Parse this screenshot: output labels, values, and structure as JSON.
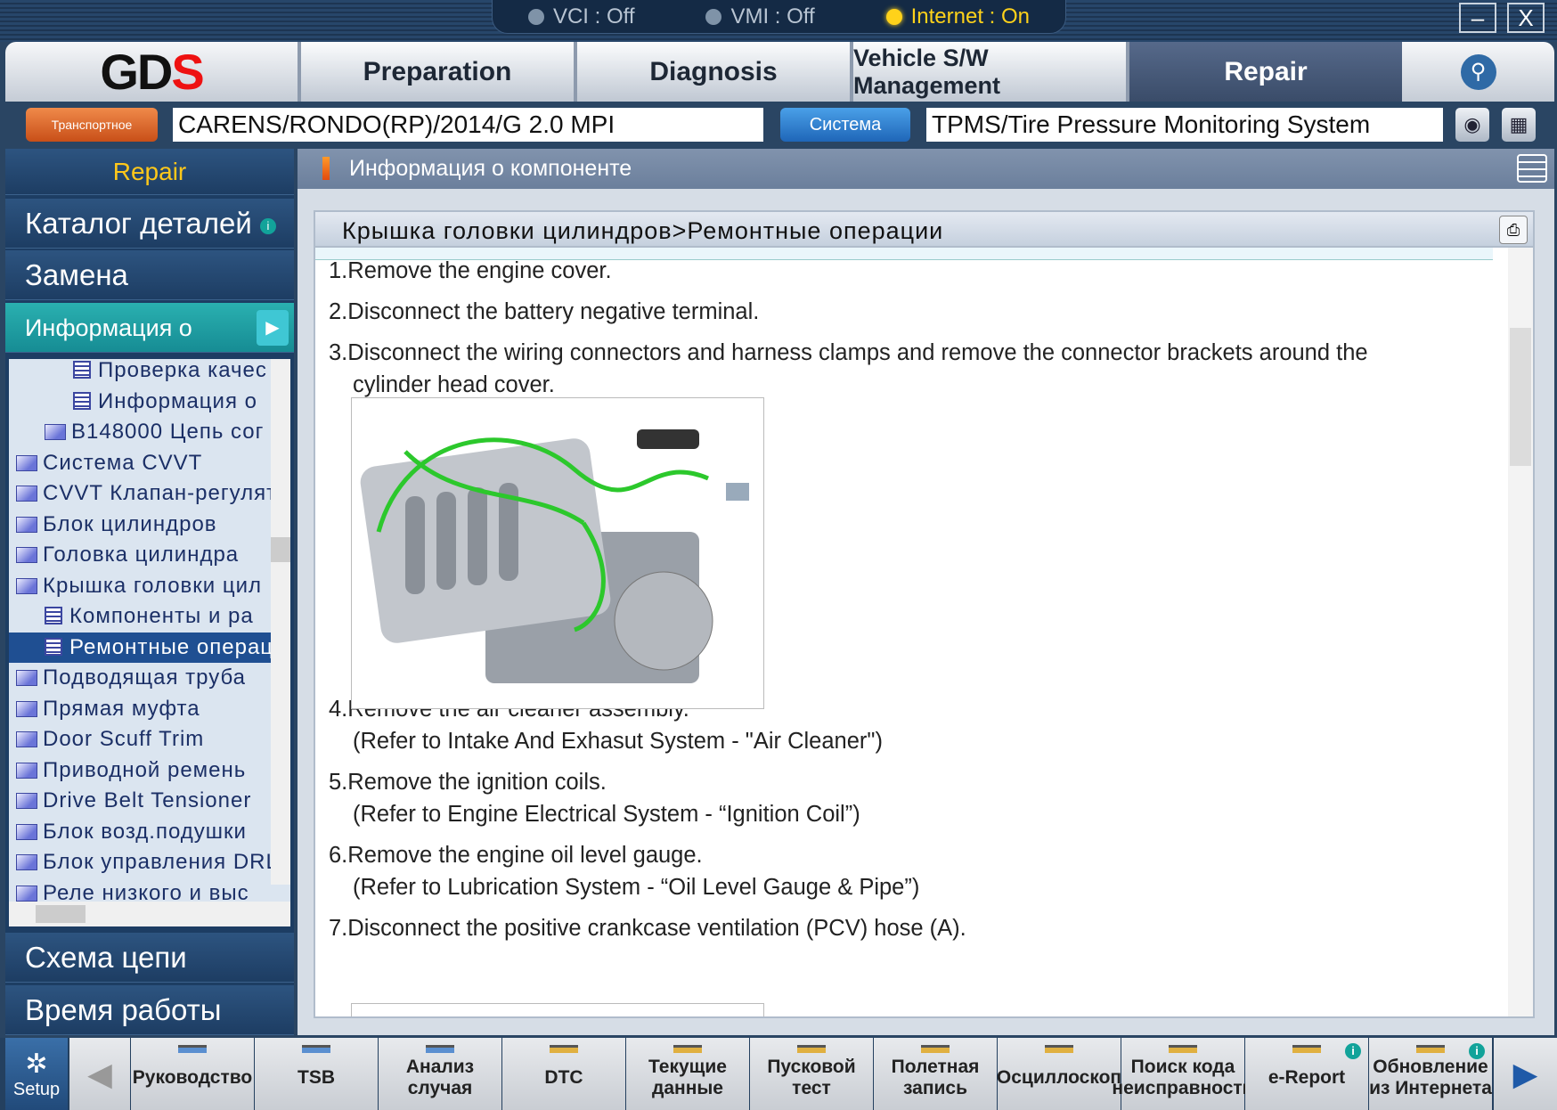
{
  "status": {
    "vci": "VCI : Off",
    "vmi": "VMI : Off",
    "internet": "Internet : On"
  },
  "window": {
    "minimize": "–",
    "close": "X"
  },
  "nav": {
    "logo": "GDS",
    "tabs": [
      "Preparation",
      "Diagnosis",
      "Vehicle S/W Management",
      "Repair"
    ],
    "active": "Repair"
  },
  "vehicle": {
    "button": "Транспортное средство",
    "value": "CARENS/RONDO(RP)/2014/G 2.0 MPI",
    "system_button": "Система",
    "system_value": "TPMS/Tire Pressure Monitoring System"
  },
  "sidebar": {
    "header": "Repair",
    "catalog": "Каталог деталей",
    "replace": "Замена",
    "component_info": "Информация о компоненте",
    "circuit": "Схема цепи",
    "work_time": "Время работы",
    "tree": [
      {
        "label": "Проверка качес",
        "type": "doc",
        "level": 2
      },
      {
        "label": "Информация о",
        "type": "doc",
        "level": 2
      },
      {
        "label": "B148000 Цепь сог",
        "type": "folder",
        "level": 1
      },
      {
        "label": "Система CVVT",
        "type": "folder",
        "level": 0
      },
      {
        "label": "CVVT Клапан-регулят",
        "type": "folder",
        "level": 0
      },
      {
        "label": "Блок цилиндров",
        "type": "folder",
        "level": 0
      },
      {
        "label": "Головка цилиндра",
        "type": "folder",
        "level": 0
      },
      {
        "label": "Крышка головки цил",
        "type": "folder-open",
        "level": 0
      },
      {
        "label": "Компоненты и ра",
        "type": "doc",
        "level": 1
      },
      {
        "label": "Ремонтные операц",
        "type": "doc",
        "level": 1,
        "selected": true
      },
      {
        "label": "Подводящая труба",
        "type": "folder",
        "level": 0
      },
      {
        "label": "Прямая муфта",
        "type": "folder",
        "level": 0
      },
      {
        "label": "Door Scuff Trim",
        "type": "folder",
        "level": 0
      },
      {
        "label": "Приводной ремень",
        "type": "folder",
        "level": 0
      },
      {
        "label": "Drive Belt Tensioner",
        "type": "folder",
        "level": 0
      },
      {
        "label": "Блок возд.подушки",
        "type": "folder",
        "level": 0
      },
      {
        "label": "Блок управления DRL",
        "type": "folder",
        "level": 0
      },
      {
        "label": "Реле низкого и выс",
        "type": "folder",
        "level": 0
      }
    ]
  },
  "main": {
    "header": "Информация о компоненте",
    "breadcrumb": "Крышка головки цилиндров>Ремонтные операции",
    "steps": [
      {
        "num": "1.",
        "text": "Remove the engine cover."
      },
      {
        "num": "2.",
        "text": "Disconnect the battery negative terminal."
      },
      {
        "num": "3.",
        "text": "Disconnect the wiring connectors and harness clamps and remove the connector brackets around the",
        "cont": "cylinder head cover."
      },
      {
        "num": "4.",
        "text": "Remove the air cleaner assembly.",
        "cont": "(Refer to Intake And Exhasut System - \"Air Cleaner\")"
      },
      {
        "num": "5.",
        "text": "Remove the ignition coils.",
        "cont": "(Refer to Engine Electrical System - “Ignition Coil”)"
      },
      {
        "num": "6.",
        "text": "Remove the engine oil level gauge.",
        "cont": "(Refer to Lubrication System - “Oil Level Gauge & Pipe”)"
      },
      {
        "num": "7.",
        "text": "Disconnect the positive crankcase ventilation (PCV) hose (A)."
      }
    ]
  },
  "bottom": {
    "setup": "Setup",
    "buttons": [
      {
        "label": "Руководство",
        "flag": "#5a8fd0"
      },
      {
        "label": "TSB",
        "flag": "#5a8fd0"
      },
      {
        "label": "Анализ случая",
        "flag": "#5a8fd0"
      },
      {
        "label": "DTC",
        "flag": "#e0b040"
      },
      {
        "label": "Текущие данные",
        "flag": "#e0b040"
      },
      {
        "label": "Пусковой тест",
        "flag": "#e0b040"
      },
      {
        "label": "Полетная запись",
        "flag": "#e0b040"
      },
      {
        "label": "Осциллоскоп",
        "flag": "#e0b040"
      },
      {
        "label": "Поиск кода неисправности",
        "flag": "#e0b040"
      },
      {
        "label": "e-Report",
        "flag": "#e0b040",
        "info": "i"
      },
      {
        "label": "Обновление из Интернета",
        "flag": "#e0b040",
        "info": "i"
      }
    ]
  }
}
